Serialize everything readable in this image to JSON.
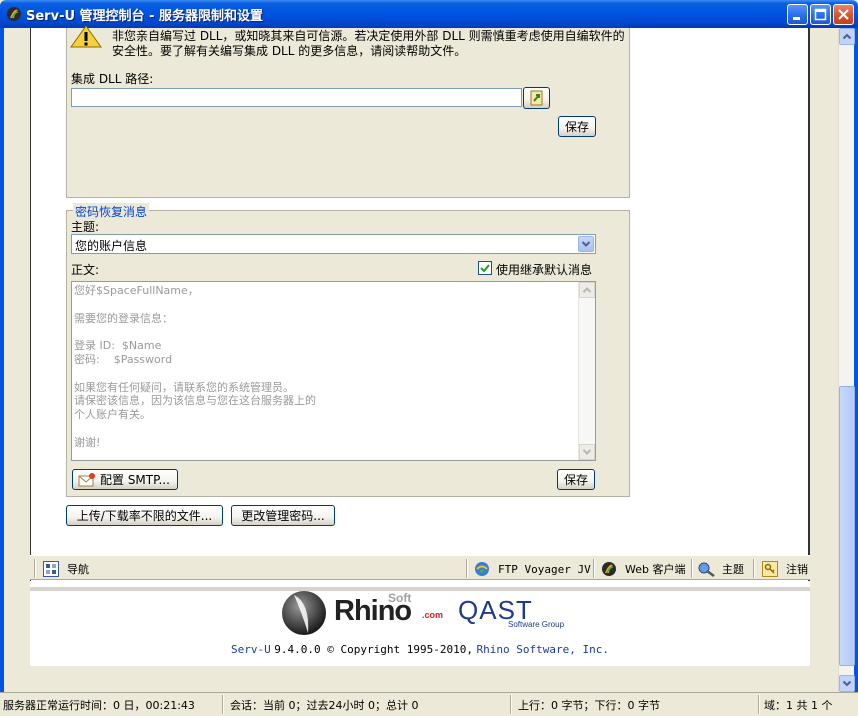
{
  "window": {
    "title": "Serv-U 管理控制台 - 服务器限制和设置",
    "colors": {
      "titlebar": "#0054e3",
      "accent": "#0046d5",
      "link": "#1a3c9c"
    }
  },
  "dll_section": {
    "warning_line1": "非您亲自编写过 DLL，或知晓其来自可信源。若决定使用外部 DLL 则需慎重考虑使用自编软件的",
    "warning_line2": "安全性。要了解有关编写集成 DLL 的更多信息，请阅读帮助文件。",
    "path_label": "集成 DLL 路径:",
    "path_value": "",
    "save_label": "保存"
  },
  "password_recovery": {
    "legend": "密码恢复消息",
    "subject_label": "主题:",
    "subject_value": "您的账户信息",
    "body_label": "正文:",
    "inherit_label": "使用继承默认消息",
    "inherit_checked": true,
    "body_lines": [
      "您好$SpaceFullName，",
      "",
      "需要您的登录信息：",
      "",
      "登录 ID:  $Name",
      "密码:    $Password",
      "",
      "如果您有任何疑问，请联系您的系统管理员。",
      "请保密该信息，因为该信息与您在这台服务器上的",
      "个人账户有关。",
      "",
      "谢谢!"
    ],
    "smtp_label": "配置 SMTP...",
    "save_label": "保存"
  },
  "actions": {
    "unlimited_files_label": "上传/下载率不限的文件...",
    "change_password_label": "更改管理密码..."
  },
  "navbar": {
    "nav_label": "导航",
    "ftp_voyager_label": "FTP Voyager JV",
    "web_client_label": "Web 客户端",
    "theme_label": "主题",
    "logout_label": "注销"
  },
  "footer": {
    "logo_rhino": "Rhino",
    "logo_soft": "Soft",
    "logo_com": ".com",
    "logo_qast": "QAST",
    "logo_qast_sub": "Software Group",
    "copyright_product": "Serv-U",
    "copyright_version": "9.4.0.0 © Copyright 1995-2010,",
    "copyright_company": "Rhino Software, Inc."
  },
  "statusbar": {
    "uptime": "服务器正常运行时间：0 日，00:21:43",
    "sessions": "会话：当前 0；过去24小时 0；总计 0",
    "transfer": "上行：0 字节；下行：0 字节",
    "domain": "域：1 共 1 个"
  }
}
